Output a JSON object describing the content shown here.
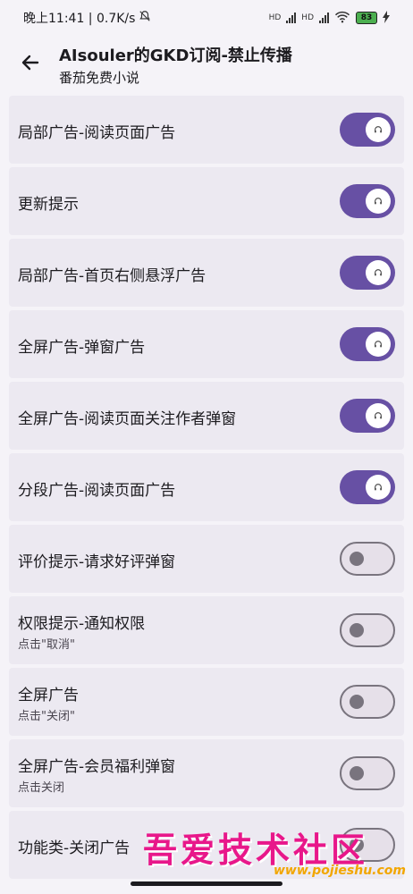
{
  "status_bar": {
    "time_speed": "晚上11:41 | 0.7K/s",
    "network_label_1": "HD",
    "network_label_2": "HD",
    "battery": "83"
  },
  "app_bar": {
    "title": "AIsouler的GKD订阅-禁止传播",
    "subtitle": "番茄免费小说"
  },
  "rules": [
    {
      "label": "局部广告-阅读页面广告",
      "desc": "",
      "enabled": true
    },
    {
      "label": "更新提示",
      "desc": "",
      "enabled": true
    },
    {
      "label": "局部广告-首页右侧悬浮广告",
      "desc": "",
      "enabled": true
    },
    {
      "label": "全屏广告-弹窗广告",
      "desc": "",
      "enabled": true
    },
    {
      "label": "全屏广告-阅读页面关注作者弹窗",
      "desc": "",
      "enabled": true
    },
    {
      "label": "分段广告-阅读页面广告",
      "desc": "",
      "enabled": true
    },
    {
      "label": "评价提示-请求好评弹窗",
      "desc": "",
      "enabled": false
    },
    {
      "label": "权限提示-通知权限",
      "desc": "点击\"取消\"",
      "enabled": false
    },
    {
      "label": "全屏广告",
      "desc": "点击\"关闭\"",
      "enabled": false
    },
    {
      "label": "全屏广告-会员福利弹窗",
      "desc": "点击关闭",
      "enabled": false
    },
    {
      "label": "功能类-关闭广告",
      "desc": "",
      "enabled": false
    }
  ],
  "watermark": {
    "text": "吾爱技术社区",
    "url": "www.pojieshu.com"
  },
  "colors": {
    "accent": "#6750a4",
    "row_bg": "#ece9f1",
    "watermark": "#e8178a"
  }
}
